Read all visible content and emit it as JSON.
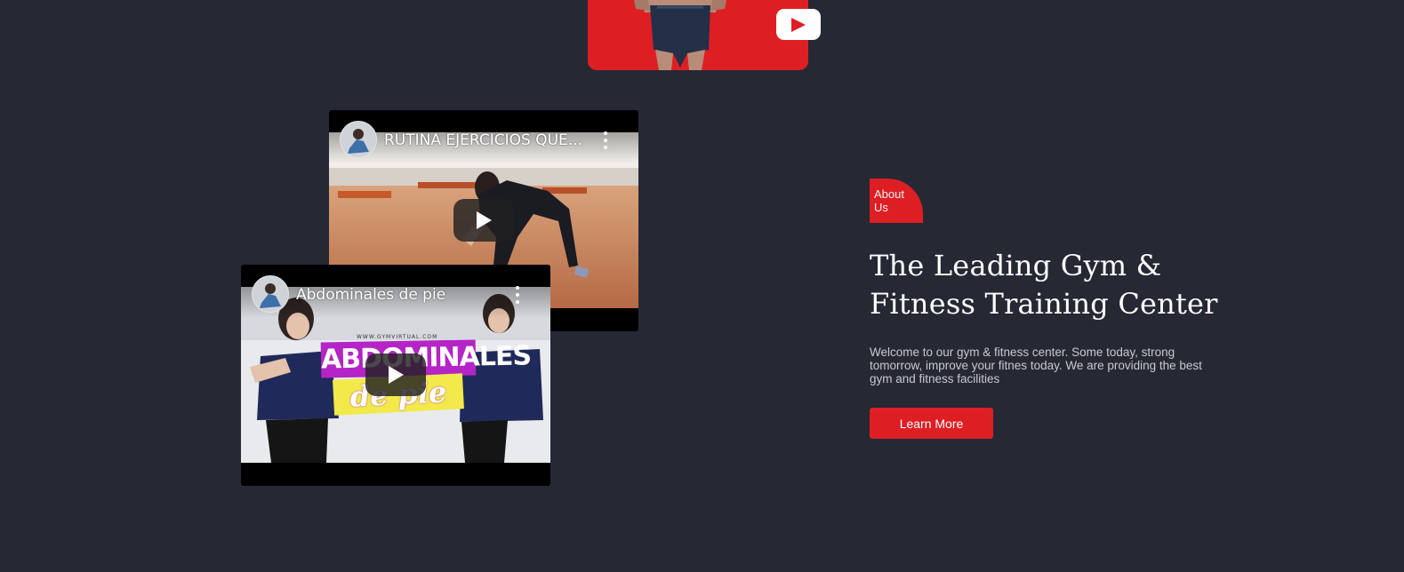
{
  "hero": {
    "icon": "youtube-play-icon",
    "accent": "#dd1f24"
  },
  "videos": [
    {
      "title": "RUTINA EJERCICIOS QUE...",
      "avatar_icon": "channel-avatar-icon",
      "menu_icon": "more-vertical-icon",
      "play_icon": "play-icon"
    },
    {
      "title": "Abdominales de pie",
      "avatar_icon": "channel-avatar-icon",
      "menu_icon": "more-vertical-icon",
      "play_icon": "play-icon",
      "thumb_text_top": "WWW.GYMVIRTUAL.COM",
      "thumb_text_main": "ABDOMINALES",
      "thumb_text_sub": "de pie"
    }
  ],
  "about": {
    "badge": "About Us",
    "headline": "The Leading Gym & Fitness Training Center",
    "description": "Welcome to our gym & fitness center. Some today, strong tomorrow, improve your fitnes today. We are providing the best gym and fitness facilities",
    "button": "Learn More"
  },
  "colors": {
    "background": "#262834",
    "accent": "#dd1f24",
    "text": "#ffffff",
    "muted_text": "#c9c9cf"
  }
}
